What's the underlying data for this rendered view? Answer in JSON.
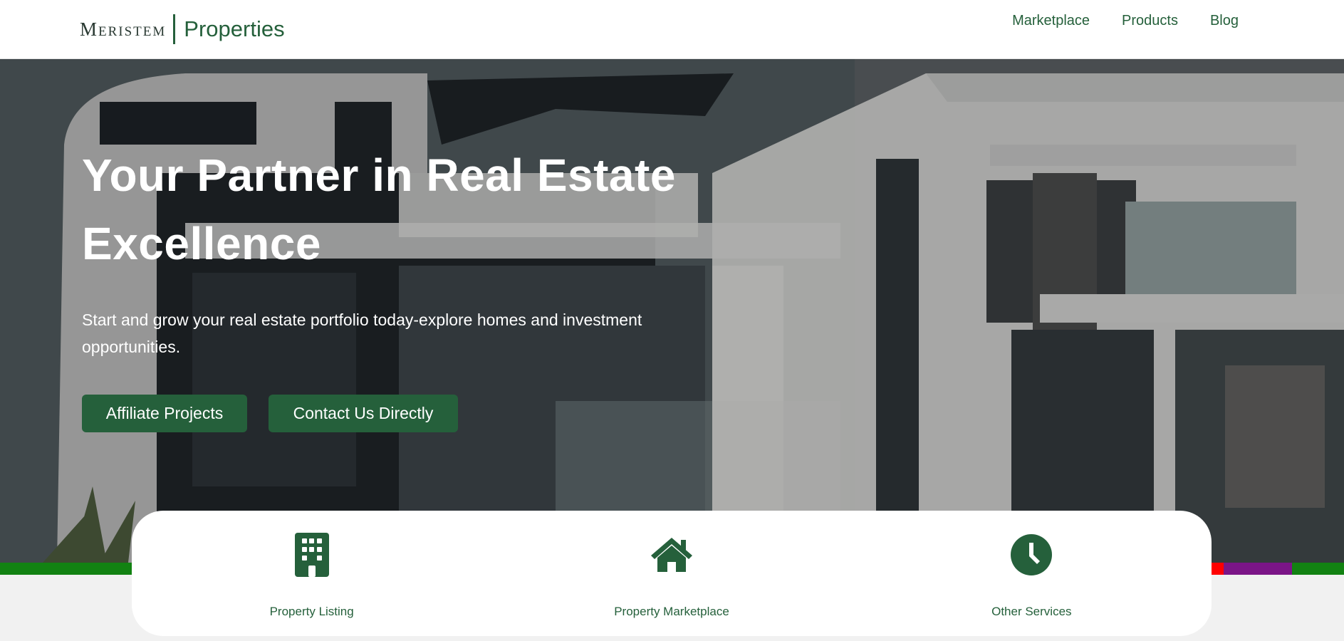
{
  "header": {
    "logo_mark": "Meristem",
    "logo_text": "Properties",
    "nav": [
      "Marketplace",
      "Products",
      "Blog"
    ]
  },
  "hero": {
    "title_line1": "Your Partner in Real Estate",
    "title_line2": "Excellence",
    "subtitle": "Start and grow your real estate portfolio today-explore homes and investment opportunities.",
    "buttons": {
      "affiliate": "Affiliate Projects",
      "contact": "Contact Us Directly"
    }
  },
  "services": [
    {
      "label": "Property Listing",
      "icon": "building-icon"
    },
    {
      "label": "Property Marketplace",
      "icon": "house-icon"
    },
    {
      "label": "Other Services",
      "icon": "clock-icon"
    }
  ],
  "colors": {
    "brand_green": "#25603b",
    "stripe": [
      "#128212",
      "#128212",
      "#ff0000",
      "#7b1587",
      "#128212"
    ]
  }
}
